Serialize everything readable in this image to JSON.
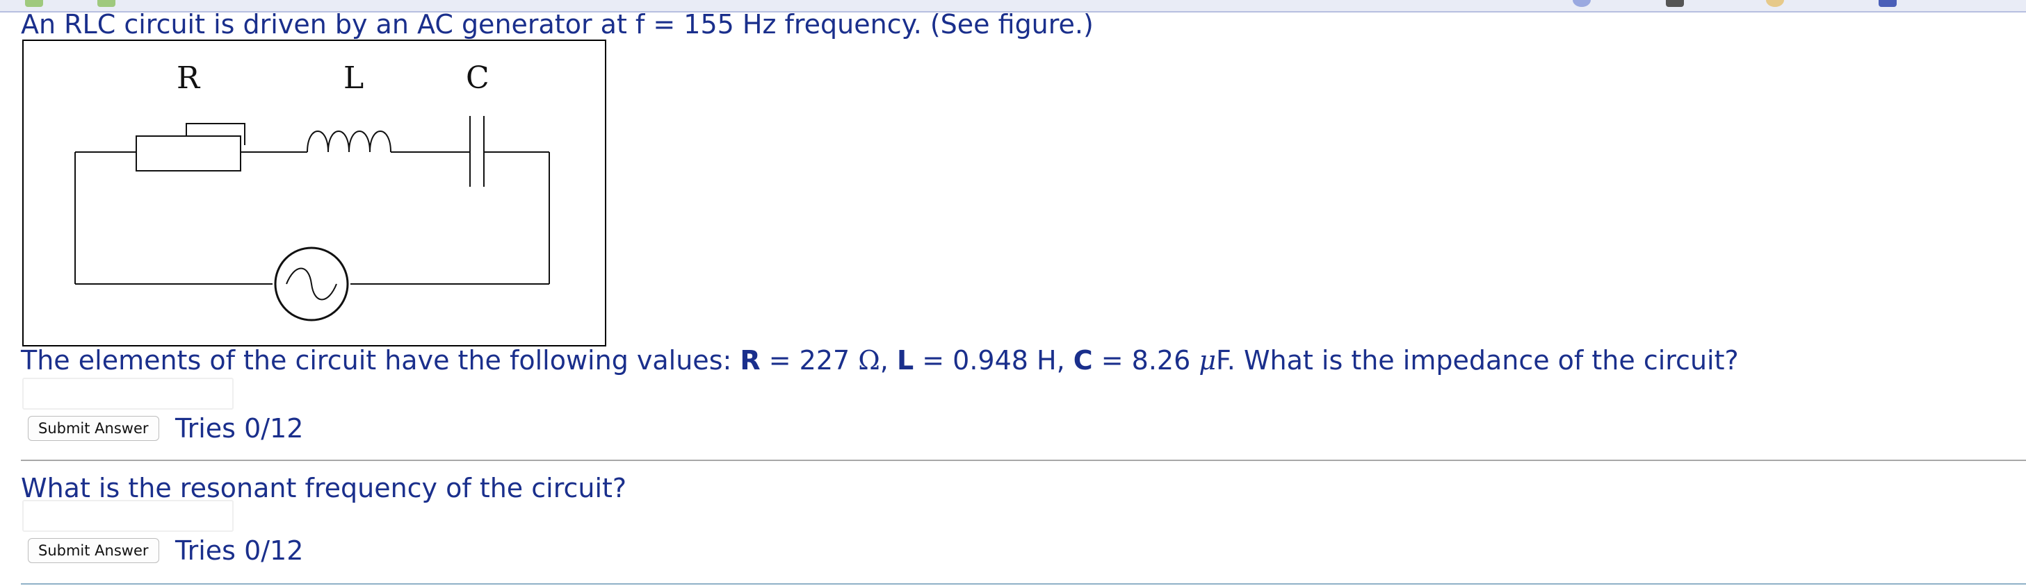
{
  "question1": {
    "text": "An RLC circuit is driven by an AC generator at f = 155 Hz frequency. (See figure.)"
  },
  "figure": {
    "label_r": "R",
    "label_l": "L",
    "label_c": "C"
  },
  "question2": {
    "intro": "The elements of the circuit have the following values: ",
    "r_label": "R",
    "r_value": " = 227 ",
    "r_unit": "Ω",
    "sep1": ", ",
    "l_label": "L",
    "l_value": " = 0.948 H, ",
    "c_label": "C",
    "c_value": " = 8.26 ",
    "c_unit_prefix": "μ",
    "c_unit": "F. What is the impedance of the circuit?"
  },
  "answer1": {
    "value": "",
    "submit_label": "Submit Answer",
    "tries": "Tries 0/12"
  },
  "question3": {
    "text": "What is the resonant frequency of the circuit?"
  },
  "answer2": {
    "value": "",
    "submit_label": "Submit Answer",
    "tries": "Tries 0/12"
  },
  "colors": {
    "text": "#1a2f8c",
    "divider": "#a8a8a8"
  }
}
